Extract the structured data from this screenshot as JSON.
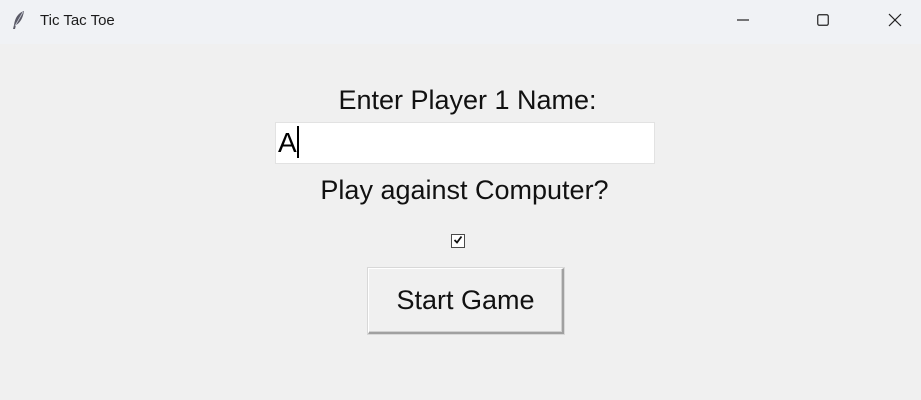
{
  "window": {
    "title": "Tic Tac Toe",
    "app_icon": "feather-icon",
    "controls": {
      "minimize_icon": "minimize-icon",
      "maximize_icon": "maximize-icon",
      "close_icon": "close-icon"
    }
  },
  "form": {
    "player_label": "Enter Player 1 Name:",
    "player_name_value": "A",
    "computer_label": "Play against Computer?",
    "computer_checked": true,
    "start_button_label": "Start Game"
  },
  "colors": {
    "background": "#f0f0f0",
    "titlebar": "#f0f2f5",
    "input_background": "#ffffff",
    "text": "#111111"
  }
}
